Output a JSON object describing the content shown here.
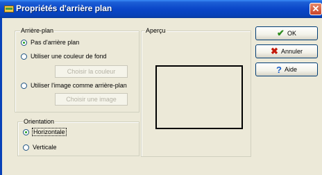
{
  "window": {
    "title": "Propriétés d'arrière plan"
  },
  "background_group": {
    "label": "Arrière-plan",
    "options": [
      {
        "label": "Pas d'arrière plan",
        "checked": true
      },
      {
        "label": "Utiliser une couleur de fond",
        "checked": false
      },
      {
        "label": "Utiliser l'image comme arrière-plan",
        "checked": false
      }
    ],
    "choose_color_label": "Choisir la couleur",
    "choose_image_label": "Choisir une image"
  },
  "orientation_group": {
    "label": "Orientation",
    "options": [
      {
        "label": "Horizontale",
        "checked": true
      },
      {
        "label": "Verticale",
        "checked": false
      }
    ]
  },
  "preview_group": {
    "label": "Aperçu"
  },
  "buttons": {
    "ok": "OK",
    "cancel": "Annuler",
    "help": "Aide"
  },
  "icons": {
    "ok": "checkmark-icon",
    "cancel": "x-icon",
    "help": "question-icon"
  }
}
